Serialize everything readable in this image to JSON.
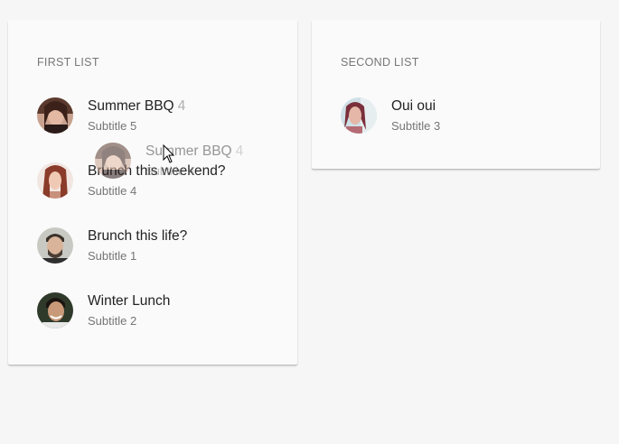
{
  "first_list": {
    "title": "FIRST LIST",
    "items": [
      {
        "title": "Summer BBQ",
        "count": "4",
        "subtitle": "Subtitle 5",
        "avatar": "woman-dark-hair-avatar"
      },
      {
        "title": "Brunch this weekend?",
        "count": "",
        "subtitle": "Subtitle 4",
        "avatar": "woman-red-hair-avatar"
      },
      {
        "title": "Brunch this life?",
        "count": "",
        "subtitle": "Subtitle 1",
        "avatar": "man-beard-avatar"
      },
      {
        "title": "Winter Lunch",
        "count": "",
        "subtitle": "Subtitle 2",
        "avatar": "man-smiling-avatar"
      }
    ]
  },
  "second_list": {
    "title": "SECOND LIST",
    "items": [
      {
        "title": "Oui oui",
        "count": "",
        "subtitle": "Subtitle 3",
        "avatar": "woman-outdoor-avatar"
      }
    ]
  },
  "drag_ghost": {
    "title": "Summer BBQ",
    "count": "4",
    "subtitle": "Subtitle 4"
  },
  "colors": {
    "card_background": "#fafafa",
    "page_background": "#f6f6f6",
    "title_text": "#222222",
    "subtitle_text": "#757575",
    "count_text": "#b0b0b0"
  }
}
